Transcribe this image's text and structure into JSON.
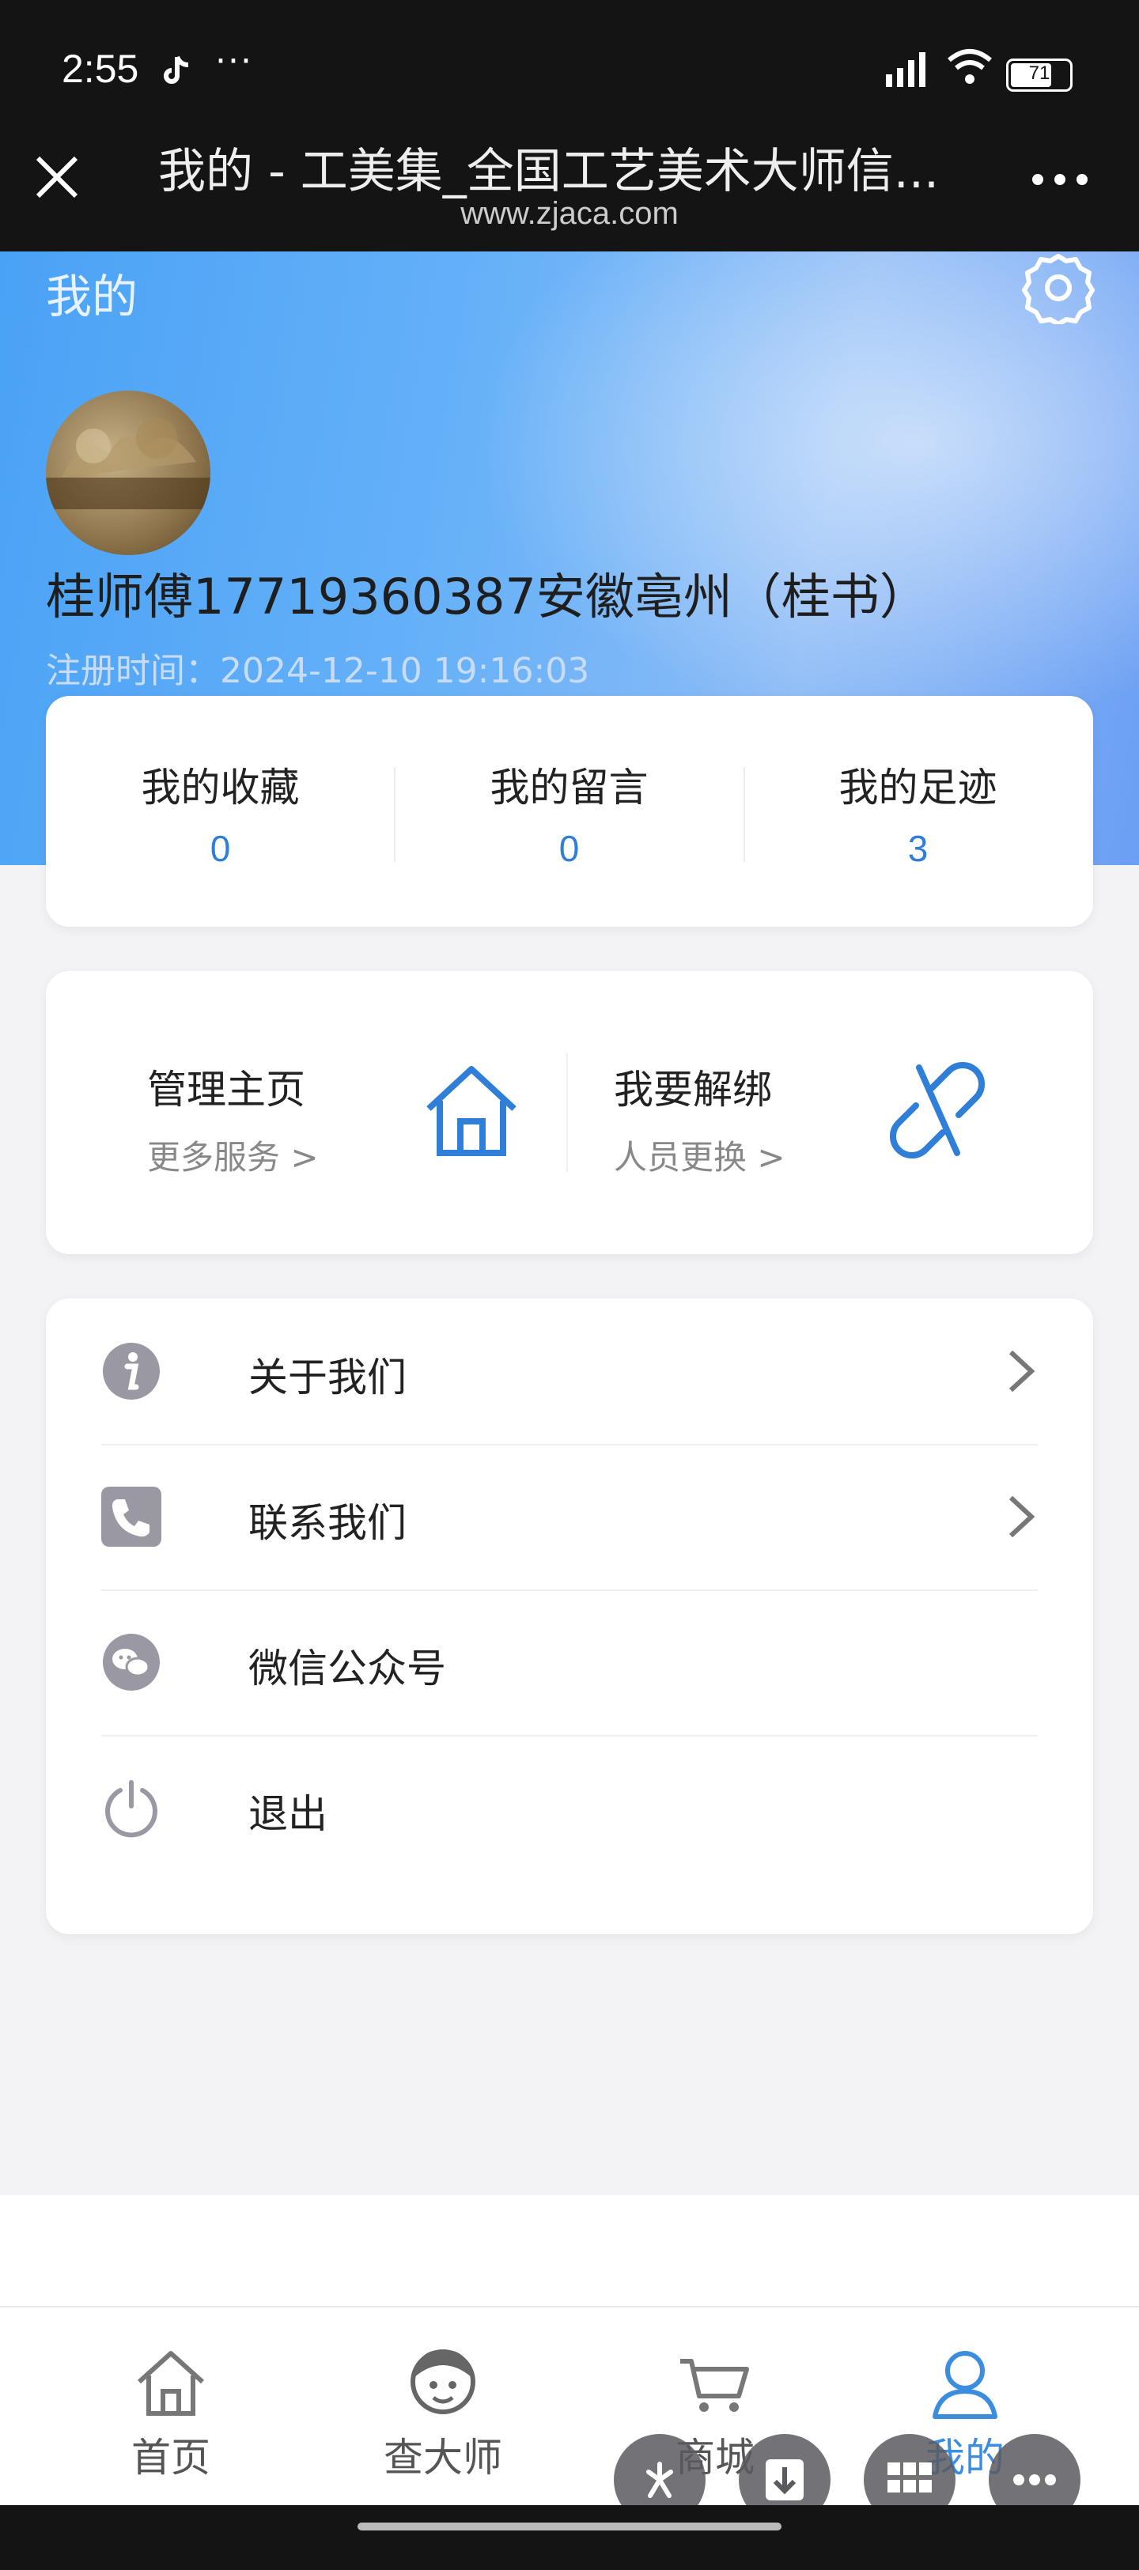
{
  "status": {
    "time": "2:55",
    "dots": "···",
    "battery": "71"
  },
  "browser": {
    "title": "我的 - 工美集_全国工艺美术大师信...",
    "url": "www.zjaca.com"
  },
  "header": {
    "title": "我的",
    "username": "桂师傅17719360387安徽亳州（桂书）",
    "register_time": "注册时间：2024-12-10 19:16:03"
  },
  "stats": [
    {
      "label": "我的收藏",
      "value": "0"
    },
    {
      "label": "我的留言",
      "value": "0"
    },
    {
      "label": "我的足迹",
      "value": "3"
    }
  ],
  "manage": [
    {
      "title": "管理主页",
      "sub": "更多服务 >"
    },
    {
      "title": "我要解绑",
      "sub": "人员更换 >"
    }
  ],
  "menu": [
    {
      "label": "关于我们",
      "icon": "info-icon"
    },
    {
      "label": "联系我们",
      "icon": "phone-icon"
    },
    {
      "label": "微信公众号",
      "icon": "wechat-icon"
    },
    {
      "label": "退出",
      "icon": "power-icon"
    }
  ],
  "tabs": [
    {
      "label": "首页",
      "icon": "home-icon"
    },
    {
      "label": "查大师",
      "icon": "master-face-icon"
    },
    {
      "label": "商城",
      "icon": "cart-icon"
    },
    {
      "label": "我的",
      "icon": "user-icon"
    }
  ],
  "colors": {
    "accent": "#2f7ed8",
    "active_tab": "#3b8de0"
  }
}
